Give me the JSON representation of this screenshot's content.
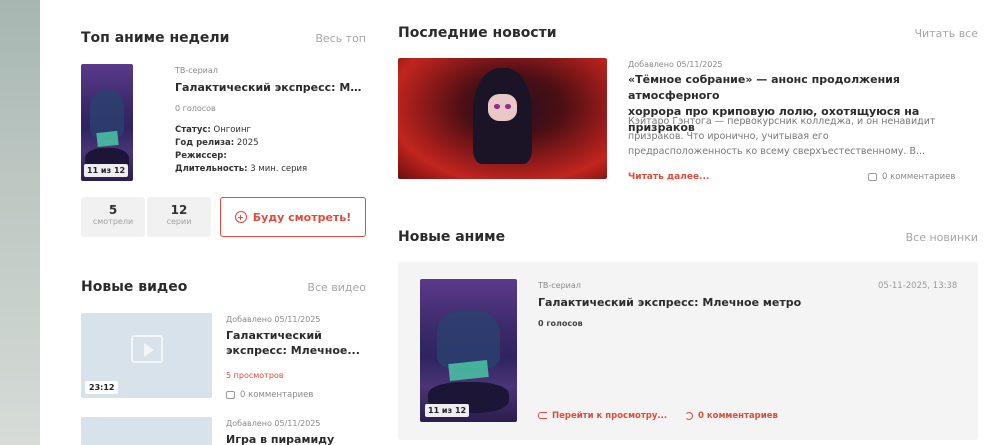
{
  "top_anime": {
    "title": "Топ аниме недели",
    "link": "Весь топ",
    "item": {
      "type": "ТВ-сериал",
      "name": "Галактический экспресс: Мле...",
      "votes": "0 голосов",
      "status_label": "Статус:",
      "status_value": "Онгоинг",
      "year_label": "Год релиза:",
      "year_value": "2025",
      "director_label": "Режиссер:",
      "director_value": "",
      "duration_label": "Длительность:",
      "duration_value": "3 мин. серия",
      "episode_badge": "11 из 12"
    },
    "stats": [
      {
        "num": "5",
        "label": "смотрели"
      },
      {
        "num": "12",
        "label": "серии"
      }
    ],
    "watch_button": "Буду смотреть!"
  },
  "new_videos": {
    "title": "Новые видео",
    "link": "Все видео",
    "items": [
      {
        "added": "Добавлено 05/11/2025",
        "name_line1": "Галактический",
        "name_line2": "экспресс: Млечное...",
        "views": "5 просмотров",
        "comments": "0 комментариев",
        "duration": "23:12"
      },
      {
        "added": "Добавлено 05/11/2025",
        "name_line1": "Игра в пирамиду"
      }
    ]
  },
  "news": {
    "title": "Последние новости",
    "link": "Читать все",
    "item": {
      "added": "Добавлено 05/11/2025",
      "headline_line1": "«Тёмное собрание» — анонс продолжения атмосферного",
      "headline_line2": "хоррора про криповую лолю, охотящуюся на призраков",
      "excerpt_line1": "Кэйтаро Гэнтога — первокурсник колледжа, и он ненавидит",
      "excerpt_line2": "призраков. Что иронично, учитывая его",
      "excerpt_line3": "предрасположенность ко всему сверхъестественному. В...",
      "read_more": "Читать далее...",
      "comments": "0 комментариев"
    }
  },
  "new_anime": {
    "title": "Новые аниме",
    "link": "Все новинки",
    "card": {
      "type": "ТВ-сериал",
      "name": "Галактический экспресс: Млечное метро",
      "votes": "0 голосов",
      "date": "05-11-2025, 13:38",
      "episode_badge": "11 из 12",
      "watch_link": "Перейти к просмотру...",
      "comments_link": "0 комментариев"
    }
  },
  "colors": {
    "accent": "#e04b3c",
    "muted": "#a6a6a6",
    "card_bg": "#f4f4f4"
  }
}
